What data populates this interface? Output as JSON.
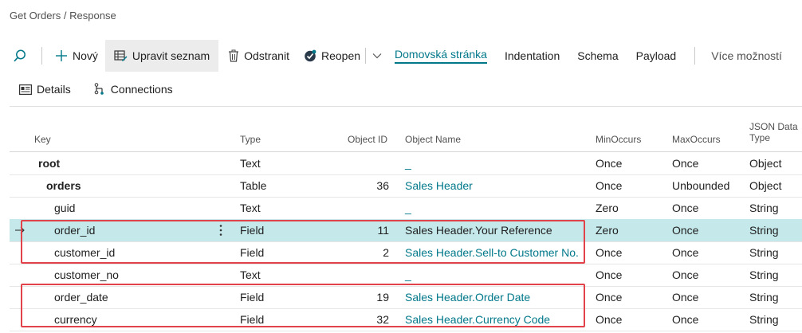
{
  "breadcrumb": "Get Orders / Response",
  "toolbar": {
    "new_label": "Nový",
    "edit_list_label": "Upravit seznam",
    "delete_label": "Odstranit",
    "reopen_label": "Reopen",
    "home_label": "Domovská stránka",
    "indentation_label": "Indentation",
    "schema_label": "Schema",
    "payload_label": "Payload",
    "more_label": "Více možností"
  },
  "subbar": {
    "details_label": "Details",
    "connections_label": "Connections"
  },
  "columns": {
    "key": "Key",
    "type": "Type",
    "object_id": "Object ID",
    "object_name": "Object Name",
    "min_occurs": "MinOccurs",
    "max_occurs": "MaxOccurs",
    "json_type_line1": "JSON Data",
    "json_type_line2": "Type"
  },
  "rows": [
    {
      "key": "root",
      "type": "Text",
      "object_id": "",
      "object_name": "_",
      "min": "Once",
      "max": "Once",
      "json": "Object"
    },
    {
      "key": "orders",
      "type": "Table",
      "object_id": "36",
      "object_name": "Sales Header",
      "min": "Once",
      "max": "Unbounded",
      "json": "Object"
    },
    {
      "key": "guid",
      "type": "Text",
      "object_id": "",
      "object_name": "_",
      "min": "Zero",
      "max": "Once",
      "json": "String"
    },
    {
      "key": "order_id",
      "type": "Field",
      "object_id": "11",
      "object_name": "Sales Header.Your Reference",
      "min": "Zero",
      "max": "Once",
      "json": "String"
    },
    {
      "key": "customer_id",
      "type": "Field",
      "object_id": "2",
      "object_name": "Sales Header.Sell-to Customer No.",
      "min": "Once",
      "max": "Once",
      "json": "String"
    },
    {
      "key": "customer_no",
      "type": "Text",
      "object_id": "",
      "object_name": "_",
      "min": "Once",
      "max": "Once",
      "json": "String"
    },
    {
      "key": "order_date",
      "type": "Field",
      "object_id": "19",
      "object_name": "Sales Header.Order Date",
      "min": "Once",
      "max": "Once",
      "json": "String"
    },
    {
      "key": "currency",
      "type": "Field",
      "object_id": "32",
      "object_name": "Sales Header.Currency Code",
      "min": "Once",
      "max": "Once",
      "json": "String"
    }
  ],
  "colors": {
    "accent": "#00788a",
    "selected_row": "#c5e9eb",
    "highlight_box": "#e2424a"
  }
}
